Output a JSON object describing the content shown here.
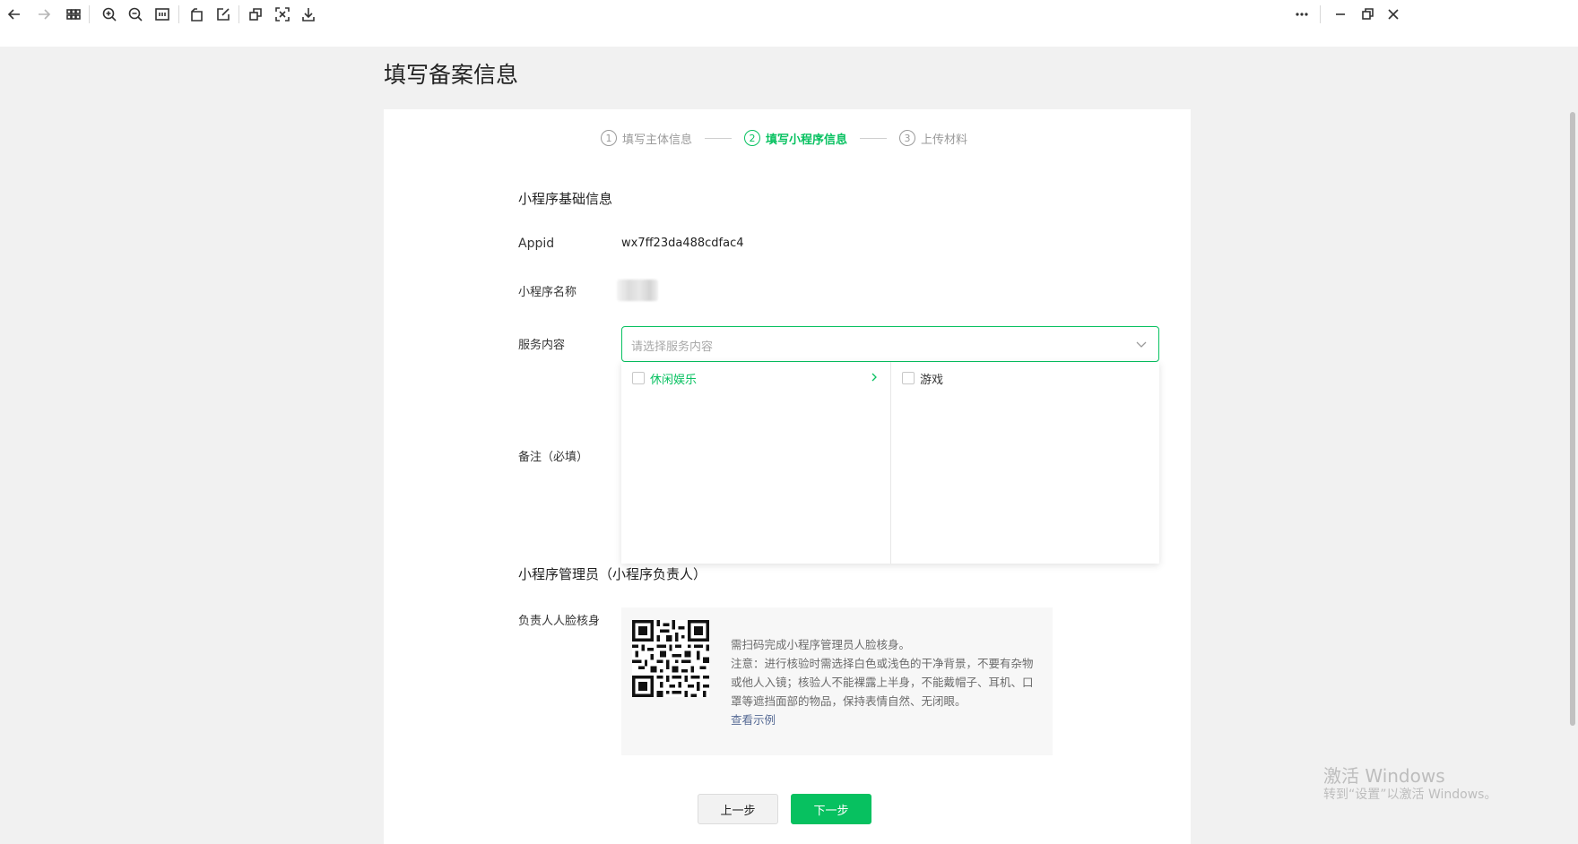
{
  "toolbar": {
    "icons": [
      "back-arrow-icon",
      "forward-arrow-icon",
      "grid-icon",
      "zoom-in-icon",
      "zoom-out-icon",
      "fit-width-icon",
      "rotate-icon",
      "edit-icon",
      "copy-icon",
      "scan-icon",
      "download-icon",
      "more-icon",
      "minimize-icon",
      "restore-icon",
      "close-icon"
    ]
  },
  "page": {
    "title": "填写备案信息"
  },
  "steps": [
    {
      "num": "1",
      "label": "填写主体信息",
      "state": "done"
    },
    {
      "num": "2",
      "label": "填写小程序信息",
      "state": "active"
    },
    {
      "num": "3",
      "label": "上传材料",
      "state": "pending"
    }
  ],
  "basic_info": {
    "section_title": "小程序基础信息",
    "appid_label": "Appid",
    "appid_value": "wx7ff23da488cdfac4",
    "name_label": "小程序名称",
    "service_label": "服务内容",
    "service_placeholder": "请选择服务内容",
    "remark_label": "备注（必填）"
  },
  "dropdown": {
    "left_item": "休闲娱乐",
    "right_item": "游戏"
  },
  "admin": {
    "section_title": "小程序管理员（小程序负责人）",
    "face_label": "负责人人脸核身",
    "line1": "需扫码完成小程序管理员人脸核身。",
    "line2": "注意：进行核验时需选择白色或浅色的干净背景，不要有杂物或他人入镜；核验人不能裸露上半身，不能戴帽子、耳机、口罩等遮挡面部的物品，保持表情自然、无闭眼。",
    "example_link": "查看示例"
  },
  "buttons": {
    "prev": "上一步",
    "next": "下一步"
  },
  "watermark": {
    "line1": "激活 Windows",
    "line2": "转到“设置”以激活 Windows。"
  },
  "colors": {
    "accent": "#07c160",
    "link": "#576b95"
  }
}
